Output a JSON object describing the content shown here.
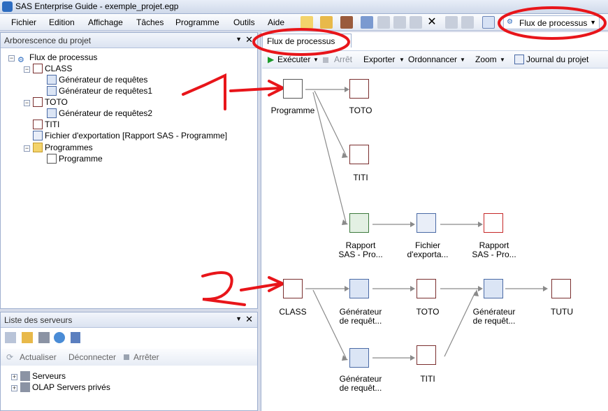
{
  "window": {
    "title": "SAS Enterprise Guide - exemple_projet.egp"
  },
  "menu": [
    "Fichier",
    "Edition",
    "Affichage",
    "Tâches",
    "Programme",
    "Outils",
    "Aide"
  ],
  "toolbar": {
    "flux_label": "Flux de processus"
  },
  "project_tree": {
    "header": "Arborescence du projet",
    "items": [
      "Flux de processus",
      "CLASS",
      "Générateur de requêtes",
      "Générateur de requêtes1",
      "TOTO",
      "Générateur de requêtes2",
      "TITI",
      "Fichier d'exportation [Rapport SAS - Programme]",
      "Programmes",
      "Programme"
    ]
  },
  "servers": {
    "header": "Liste des serveurs",
    "actions": {
      "refresh": "Actualiser",
      "disconnect": "Déconnecter",
      "stop": "Arrêter"
    },
    "items": [
      "Serveurs",
      "OLAP Servers privés"
    ]
  },
  "flow": {
    "tab": "Flux de processus",
    "toolbar": {
      "run": "Exécuter",
      "stop": "Arrêt",
      "export": "Exporter",
      "schedule": "Ordonnancer",
      "zoom": "Zoom",
      "journal": "Journal du projet"
    },
    "nodes": {
      "programme": "Programme",
      "toto1": "TOTO",
      "titi1": "TITI",
      "rapport1_a": "Rapport",
      "rapport1_b": "SAS - Pro...",
      "fichier_a": "Fichier",
      "fichier_b": "d'exporta...",
      "rapport2_a": "Rapport",
      "rapport2_b": "SAS - Pro...",
      "class": "CLASS",
      "gen1_a": "Générateur",
      "gen1_b": "de requêt...",
      "toto2": "TOTO",
      "gen2_a": "Générateur",
      "gen2_b": "de requêt...",
      "tutu": "TUTU",
      "gen3_a": "Générateur",
      "gen3_b": "de requêt...",
      "titi2": "TITI"
    }
  },
  "annotations": {
    "one": "1",
    "two": "2"
  },
  "colors": {
    "annotation": "#e8151a"
  }
}
